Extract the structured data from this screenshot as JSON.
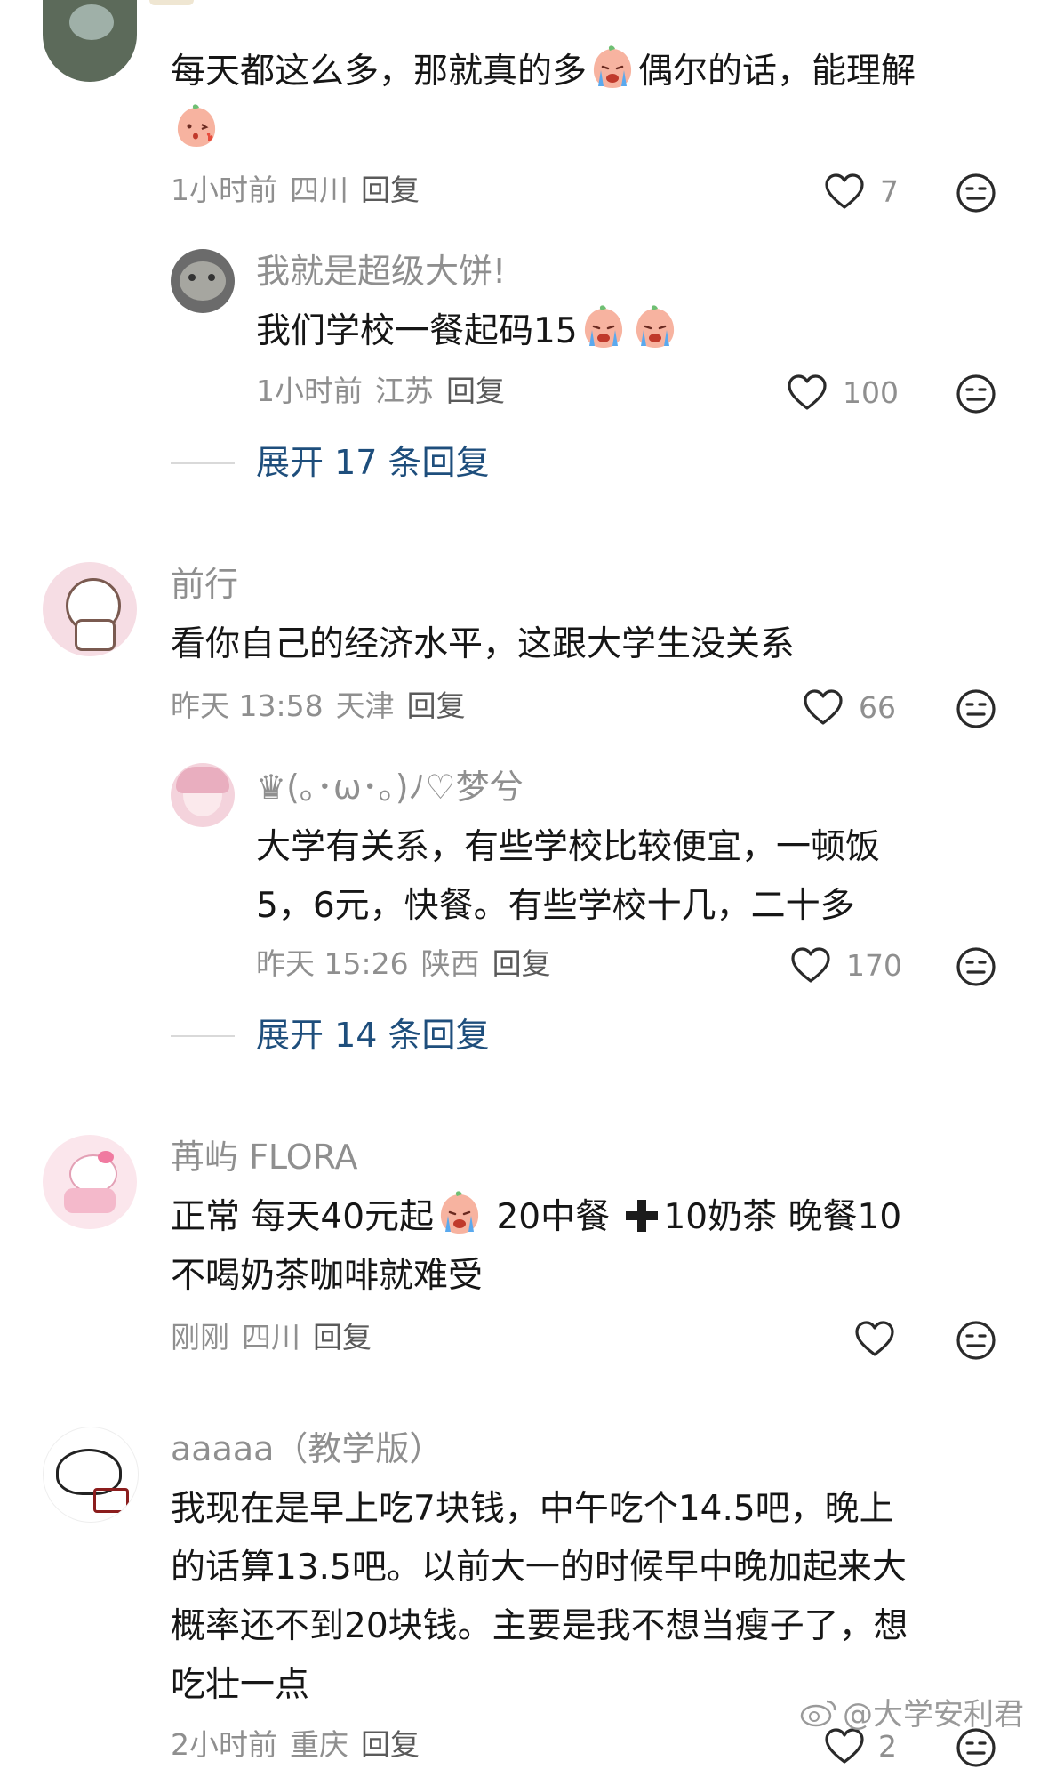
{
  "comments": [
    {
      "text_a": "每天都这么多，那就真的多",
      "text_b": "偶尔的话，能理解",
      "meta": {
        "time": "1小时前",
        "location": "四川",
        "reply": "回复"
      },
      "likes": "7",
      "replies": [
        {
          "username": "我就是超级大饼!",
          "text": "我们学校一餐起码15",
          "meta": {
            "time": "1小时前",
            "location": "江苏",
            "reply": "回复"
          },
          "likes": "100"
        }
      ],
      "expand": "展开 17 条回复"
    },
    {
      "username": "前行",
      "text": "看你自己的经济水平，这跟大学生没关系",
      "meta": {
        "time": "昨天 13:58",
        "location": "天津",
        "reply": "回复"
      },
      "likes": "66",
      "replies": [
        {
          "username": "♛(｡･ω･｡)ﾉ♡梦兮",
          "text_line1": "大学有关系，有些学校比较便宜，一顿饭",
          "text_line2": "5，6元，快餐。有些学校十几，二十多",
          "meta": {
            "time": "昨天 15:26",
            "location": "陕西",
            "reply": "回复"
          },
          "likes": "170"
        }
      ],
      "expand": "展开 14 条回复"
    },
    {
      "username": "苒屿 FLORA",
      "text_a": "正常 每天40元起",
      "text_b": "20中餐",
      "text_c": "10奶茶 晚餐10",
      "text_line2": "不喝奶茶咖啡就难受",
      "meta": {
        "time": "刚刚",
        "location": "四川",
        "reply": "回复"
      },
      "likes": ""
    },
    {
      "username": "aaaaa（教学版）",
      "text_line1": "我现在是早上吃7块钱，中午吃个14.5吧，晚上",
      "text_line2": "的话算13.5吧。以前大一的时候早中晚加起来大",
      "text_line3": "概率还不到20块钱。主要是我不想当瘦子了，想",
      "text_line4": "吃壮一点",
      "meta": {
        "time": "2小时前",
        "location": "重庆",
        "reply": "回复"
      },
      "likes": "2"
    }
  ],
  "watermark": "@大学安利君",
  "icons": {
    "like": "heart-outline-icon",
    "dislike": "neutral-face-icon",
    "plus": "heavy-plus-icon",
    "emoji": "crying-peach-emoji"
  },
  "colors": {
    "text": "#161616",
    "muted": "#8f8f8f",
    "link": "#1e4e7c",
    "background": "#ffffff"
  }
}
